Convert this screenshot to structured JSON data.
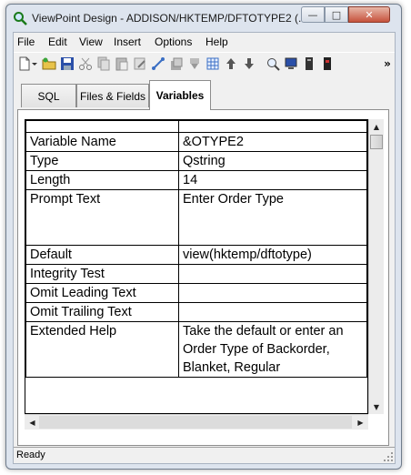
{
  "window": {
    "title": "ViewPoint Design - ADDISON/HKTEMP/DFTOTYPE2 (..."
  },
  "menu": {
    "items": [
      {
        "label": "File",
        "name": "menu-file"
      },
      {
        "label": "Edit",
        "name": "menu-edit"
      },
      {
        "label": "View",
        "name": "menu-view"
      },
      {
        "label": "Insert",
        "name": "menu-insert"
      },
      {
        "label": "Options",
        "name": "menu-options"
      },
      {
        "label": "Help",
        "name": "menu-help"
      }
    ]
  },
  "toolbar": {
    "icons": [
      "new-document-icon",
      "dropdown-arrow-icon",
      "open-folder-icon",
      "save-icon",
      "cut-icon",
      "copy-icon",
      "paste-icon",
      "edit-icon",
      "link-icon",
      "layers-icon",
      "download-icon",
      "grid-icon",
      "move-up-icon",
      "move-down-icon",
      "zoom-icon",
      "monitor-icon",
      "server-icon",
      "database-icon"
    ],
    "overflow": "»"
  },
  "tabs": [
    {
      "label": "SQL",
      "name": "tab-sql",
      "active": false
    },
    {
      "label": "Files & Fields",
      "name": "tab-files-fields",
      "active": false
    },
    {
      "label": "Variables",
      "name": "tab-variables",
      "active": true
    }
  ],
  "grid": {
    "rows": [
      {
        "name": "Variable Name",
        "value": "&OTYPE2"
      },
      {
        "name": "Type",
        "value": "Qstring"
      },
      {
        "name": "Length",
        "value": "14"
      },
      {
        "name": "Prompt Text",
        "value": "Enter Order Type"
      },
      {
        "name": "Default",
        "value": "view(hktemp/dftotype)"
      },
      {
        "name": "Integrity Test",
        "value": ""
      },
      {
        "name": "Omit Leading Text",
        "value": ""
      },
      {
        "name": "Omit Trailing Text",
        "value": ""
      },
      {
        "name": "Extended Help",
        "value": "Take the default or enter an Order Type of Backorder, Blanket, Regular"
      }
    ]
  },
  "status": {
    "text": "Ready"
  },
  "colors": {
    "frame": "#dde4ee",
    "close_button": "#c6523c",
    "grid_line": "#000000"
  }
}
